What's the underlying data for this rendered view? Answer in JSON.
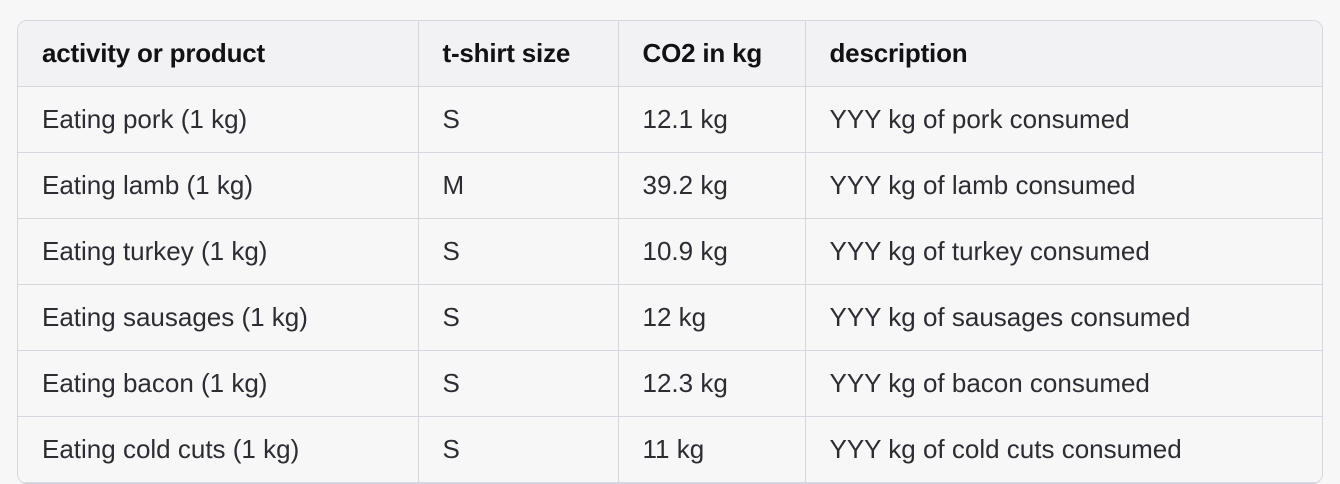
{
  "table": {
    "headers": [
      "activity or product",
      "t-shirt size",
      "CO2 in kg",
      "description"
    ],
    "rows": [
      [
        "Eating pork (1 kg)",
        "S",
        "12.1 kg",
        "YYY kg of pork consumed"
      ],
      [
        "Eating lamb (1 kg)",
        "M",
        "39.2 kg",
        "YYY kg of lamb consumed"
      ],
      [
        "Eating turkey (1 kg)",
        "S",
        "10.9 kg",
        "YYY kg of turkey consumed"
      ],
      [
        "Eating sausages (1 kg)",
        "S",
        "12 kg",
        "YYY kg of sausages consumed"
      ],
      [
        "Eating bacon (1 kg)",
        "S",
        "12.3 kg",
        "YYY kg of bacon consumed"
      ],
      [
        "Eating cold cuts (1 kg)",
        "S",
        "11 kg",
        "YYY kg of cold cuts consumed"
      ]
    ]
  }
}
